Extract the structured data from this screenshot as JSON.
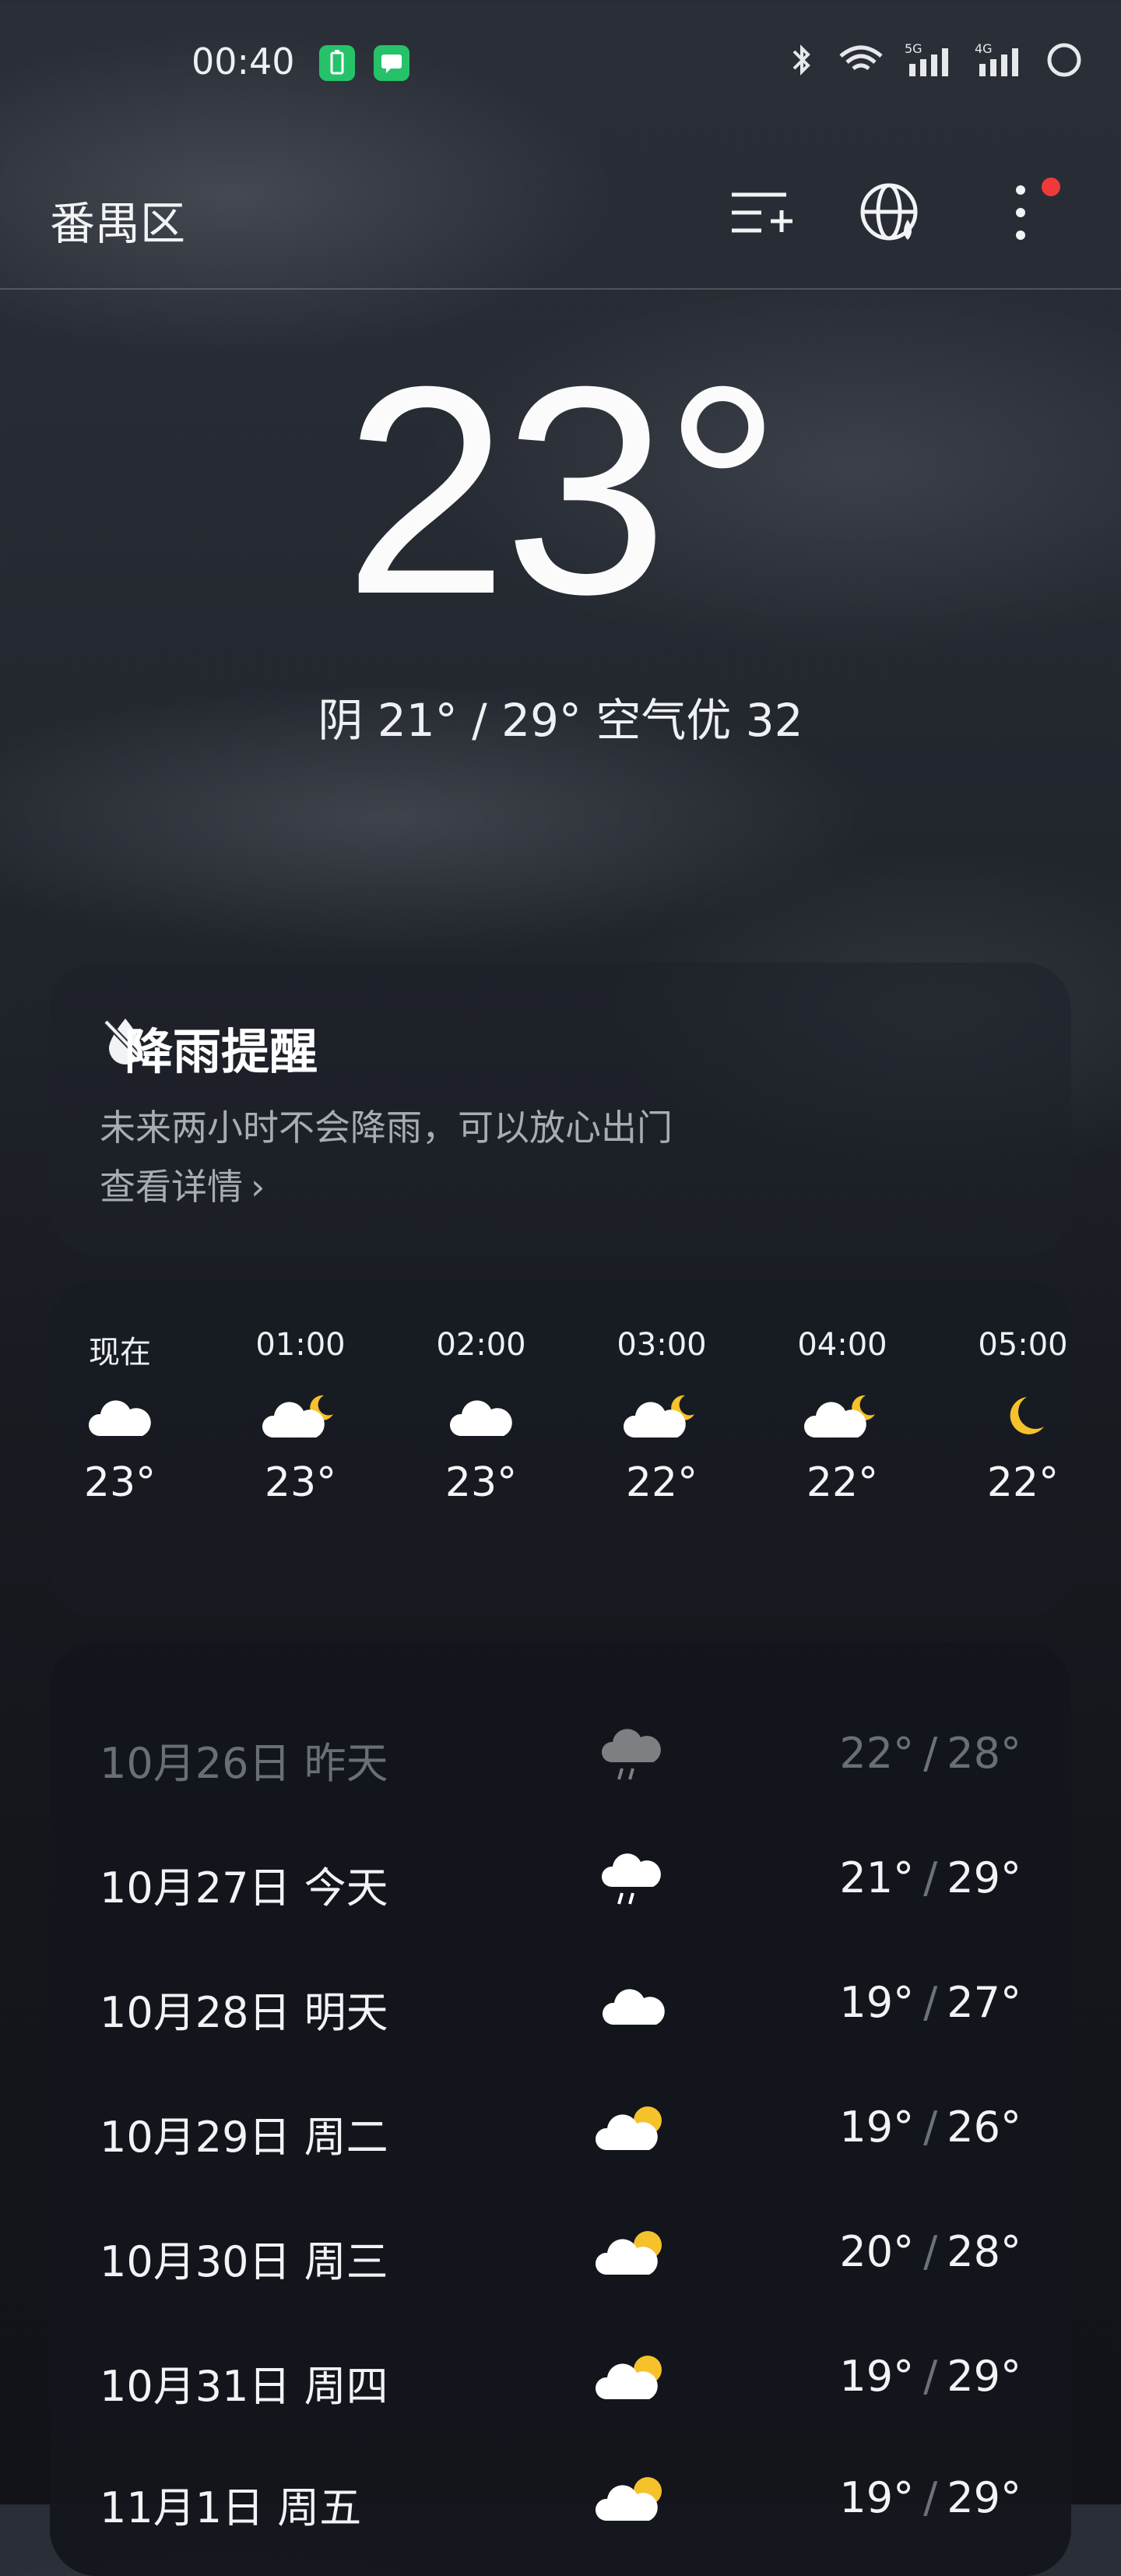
{
  "status_bar": {
    "time": "00:40"
  },
  "header": {
    "city": "番禺区"
  },
  "current": {
    "temperature": "23°",
    "summary": "阴  21° / 29°  空气优 32"
  },
  "rain_alert": {
    "title": "降雨提醒",
    "message": "未来两小时不会降雨，可以放心出门",
    "link": "查看详情"
  },
  "hourly": [
    {
      "time": "现在",
      "icon": "cloud-icon",
      "temp": "23°"
    },
    {
      "time": "01:00",
      "icon": "cloud-moon-icon",
      "temp": "23°"
    },
    {
      "time": "02:00",
      "icon": "cloud-icon",
      "temp": "23°"
    },
    {
      "time": "03:00",
      "icon": "cloud-moon-icon",
      "temp": "22°"
    },
    {
      "time": "04:00",
      "icon": "cloud-moon-icon",
      "temp": "22°"
    },
    {
      "time": "05:00",
      "icon": "moon-icon",
      "temp": "22°"
    }
  ],
  "daily": [
    {
      "date": "10月26日  昨天",
      "icon": "rain-icon",
      "low": "22°",
      "high": "28°",
      "past": true
    },
    {
      "date": "10月27日  今天",
      "icon": "rain-icon",
      "low": "21°",
      "high": "29°"
    },
    {
      "date": "10月28日  明天",
      "icon": "cloud-icon",
      "low": "19°",
      "high": "27°"
    },
    {
      "date": "10月29日  周二",
      "icon": "cloud-sun-icon",
      "low": "19°",
      "high": "26°"
    },
    {
      "date": "10月30日  周三",
      "icon": "cloud-sun-icon",
      "low": "20°",
      "high": "28°"
    },
    {
      "date": "10月31日  周四",
      "icon": "cloud-sun-icon",
      "low": "19°",
      "high": "29°"
    },
    {
      "date": "11月1日  周五",
      "icon": "cloud-sun-icon",
      "low": "19°",
      "high": "29°"
    }
  ],
  "colors": {
    "sun": "#f5c22b",
    "cloud": "#ffffff",
    "accent_red": "#ef3a3a"
  }
}
